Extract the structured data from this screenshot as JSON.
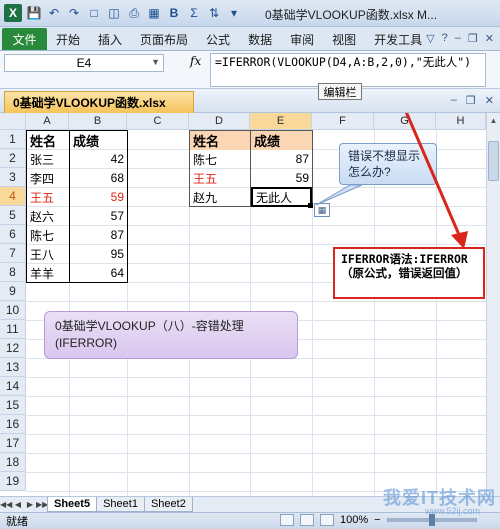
{
  "window": {
    "title": "0基础学VLOOKUP函数.xlsx M..."
  },
  "ribbon": {
    "file_tab": "文件",
    "tabs": [
      "开始",
      "插入",
      "页面布局",
      "公式",
      "数据",
      "审阅",
      "视图",
      "开发工具"
    ]
  },
  "formula_bar": {
    "name_box": "E4",
    "fx_label": "fx",
    "formula": "=IFERROR(VLOOKUP(D4,A:B,2,0),\"无此人\")",
    "tooltip": "编辑栏"
  },
  "workbook": {
    "tab_label": "0基础学VLOOKUP函数.xlsx"
  },
  "grid": {
    "columns": [
      "A",
      "B",
      "C",
      "D",
      "E",
      "F",
      "G",
      "H"
    ],
    "rows": [
      "1",
      "2",
      "3",
      "4",
      "5",
      "6",
      "7",
      "8",
      "9",
      "10",
      "11",
      "12",
      "13",
      "14",
      "15",
      "16",
      "17",
      "18",
      "19"
    ],
    "selected_col": "E",
    "selected_row": "4"
  },
  "left_table": {
    "headers": [
      "姓名",
      "成绩"
    ],
    "rows": [
      {
        "name": "张三",
        "score": "42"
      },
      {
        "name": "李四",
        "score": "68"
      },
      {
        "name": "王五",
        "score": "59"
      },
      {
        "name": "赵六",
        "score": "57"
      },
      {
        "name": "陈七",
        "score": "87"
      },
      {
        "name": "王八",
        "score": "95"
      },
      {
        "name": "羊羊",
        "score": "64"
      }
    ]
  },
  "right_table": {
    "headers": [
      "姓名",
      "成绩"
    ],
    "rows": [
      {
        "name": "陈七",
        "score": "87"
      },
      {
        "name": "王五",
        "score": "59"
      },
      {
        "name": "赵九",
        "score": "无此人"
      }
    ]
  },
  "annotations": {
    "callout": "错误不想显示怎么办?",
    "red_box": "IFERROR语法:IFERROR（原公式，错误返回值）",
    "note": "0基础学VLOOKUP（八）-容错处理(IFERROR)"
  },
  "sheets": {
    "tabs": [
      "Sheet5",
      "Sheet1",
      "Sheet2"
    ],
    "active": "Sheet5"
  },
  "status": {
    "ready": "就绪",
    "zoom": "100%"
  },
  "watermark": {
    "main": "我爱IT技术网",
    "sub": "www.52ij.com"
  },
  "colors": {
    "accent_red": "#d9251c",
    "header_fill": "#f9d99a",
    "file_tab": "#2a8a3c"
  }
}
